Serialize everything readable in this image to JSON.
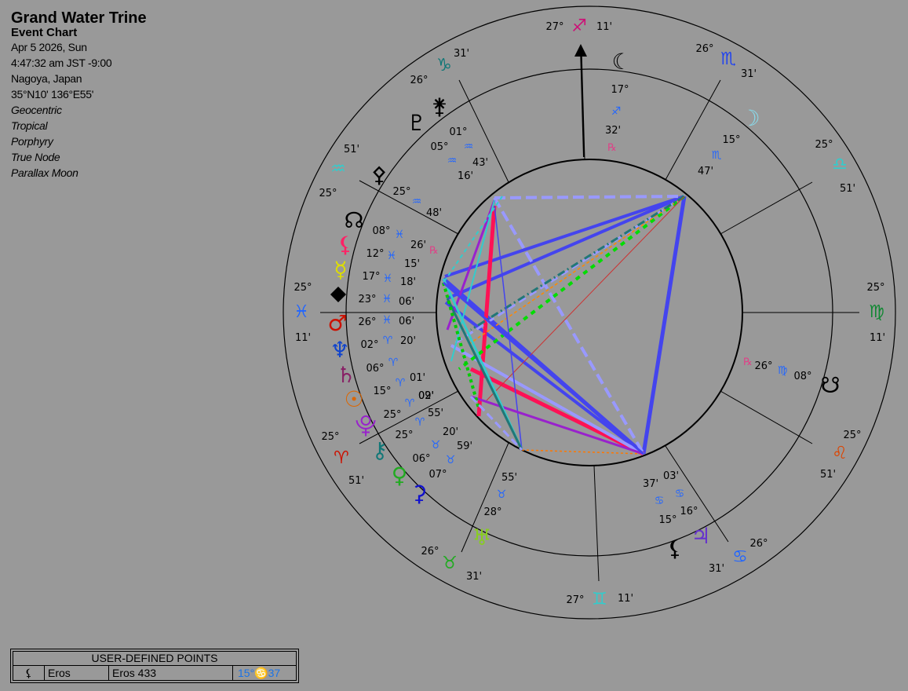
{
  "header": {
    "title": "Grand Water Trine",
    "subtitle": "Event Chart",
    "date": "Apr 5 2026, Sun",
    "time": "4:47:32 am  JST -9:00",
    "place": "Nagoya, Japan",
    "coords": "35°N10' 136°E55'",
    "settings": [
      "Geocentric",
      "Tropical",
      "Porphyry",
      "True Node",
      "Parallax Moon"
    ]
  },
  "colors": {
    "background": "#999999",
    "fire": "#cc1100",
    "earth": "#118833",
    "air": "#33cccc",
    "water": "#2266ff",
    "trine": "#4444ee",
    "square": "#ff1155",
    "sextile_dash": "#9999ff"
  },
  "signs_on_cusps": [
    {
      "sign": "sagittarius-glyph",
      "glyph": "♐",
      "deg": "27°",
      "min": "11'",
      "color": "#cc1177"
    },
    {
      "sign": "scorpio-glyph",
      "glyph": "♏",
      "deg": "26°",
      "min": "31'",
      "color": "#2244ee"
    },
    {
      "sign": "libra-glyph",
      "glyph": "♎",
      "deg": "25°",
      "min": "51'",
      "color": "#33cccc"
    },
    {
      "sign": "virgo-glyph",
      "glyph": "♍",
      "deg": "25°",
      "min": "11'",
      "color": "#118833"
    },
    {
      "sign": "leo-glyph",
      "glyph": "♌",
      "deg": "25°",
      "min": "51'",
      "color": "#dd4400"
    },
    {
      "sign": "cancer-glyph",
      "glyph": "♋",
      "deg": "26°",
      "min": "31'",
      "color": "#2266ff"
    },
    {
      "sign": "gemini-glyph",
      "glyph": "♊",
      "deg": "27°",
      "min": "11'",
      "color": "#33cccc"
    },
    {
      "sign": "taurus-glyph",
      "glyph": "♉",
      "deg": "26°",
      "min": "31'",
      "color": "#22aa22"
    },
    {
      "sign": "aries-glyph",
      "glyph": "♈",
      "deg": "25°",
      "min": "51'",
      "color": "#cc1100"
    },
    {
      "sign": "pisces-glyph",
      "glyph": "♓",
      "deg": "25°",
      "min": "11'",
      "color": "#2266ff"
    },
    {
      "sign": "aquarius-glyph",
      "glyph": "♒",
      "deg": "25°",
      "min": "51'",
      "color": "#33cccc"
    },
    {
      "sign": "capricorn-glyph",
      "glyph": "♑",
      "deg": "26°",
      "min": "31'",
      "color": "#117777"
    }
  ],
  "planets": [
    {
      "name": "moon",
      "glyph": "☾",
      "color": "#000000",
      "deg": "17°",
      "sign": "♐",
      "min": "32'",
      "retro": "℞"
    },
    {
      "name": "moon-2",
      "glyph": "☽",
      "color": "#88ddee",
      "deg": "15°",
      "sign": "♏",
      "min": "47'"
    },
    {
      "name": "south-node",
      "glyph": "☋",
      "color": "#000000",
      "deg": "26°",
      "sign": "♍",
      "min": "08°",
      "retro": "℞"
    },
    {
      "name": "jupiter",
      "glyph": "♃",
      "color": "#6633cc",
      "deg": "16°",
      "sign": "♋",
      "min": "03'"
    },
    {
      "name": "eros",
      "glyph": "⚸",
      "color": "#000000",
      "deg": "15°",
      "sign": "♋",
      "min": "37'"
    },
    {
      "name": "uranus",
      "glyph": "♅",
      "color": "#88cc22",
      "deg": "28°",
      "sign": "♉",
      "min": "55'"
    },
    {
      "name": "ceres",
      "glyph": "⚳",
      "color": "#1111cc",
      "deg": "07°",
      "sign": "♉",
      "min": "59'"
    },
    {
      "name": "venus",
      "glyph": "♀",
      "color": "#22aa22",
      "deg": "06°",
      "sign": "♉",
      "min": "20'"
    },
    {
      "name": "chiron",
      "glyph": "⚷",
      "color": "#117777",
      "deg": "25°",
      "sign": "♈",
      "min": "55'"
    },
    {
      "name": "proserpina",
      "glyph": "⯓",
      "color": "#9922cc",
      "deg": "25°",
      "sign": "♈",
      "min": "09'"
    },
    {
      "name": "sun",
      "glyph": "☉",
      "color": "#dd6600",
      "deg": "15°",
      "sign": "♈",
      "min": "02'"
    },
    {
      "name": "saturn",
      "glyph": "♄",
      "color": "#882266",
      "deg": "06°",
      "sign": "♈",
      "min": "01'"
    },
    {
      "name": "neptune",
      "glyph": "♆",
      "color": "#1144cc",
      "deg": "02°",
      "sign": "♈",
      "min": "20'"
    },
    {
      "name": "mars",
      "glyph": "♂",
      "color": "#cc1100",
      "deg": "26°",
      "sign": "♓",
      "min": "06'"
    },
    {
      "name": "vertex",
      "glyph": "⯁",
      "color": "#000000",
      "deg": "23°",
      "sign": "♓",
      "min": "06'"
    },
    {
      "name": "mercury",
      "glyph": "☿",
      "color": "#dddd00",
      "deg": "17°",
      "sign": "♓",
      "min": "18'"
    },
    {
      "name": "lilith",
      "glyph": "⚸",
      "color": "#ff2266",
      "deg": "12°",
      "sign": "♓",
      "min": "15'"
    },
    {
      "name": "north-node",
      "glyph": "☊",
      "color": "#000000",
      "deg": "08°",
      "sign": "♓",
      "min": "26'",
      "retro": "℞"
    },
    {
      "name": "pallas",
      "glyph": "⚴",
      "color": "#000000",
      "deg": "25°",
      "sign": "♒",
      "min": "48'"
    },
    {
      "name": "pluto",
      "glyph": "♇",
      "color": "#000000",
      "deg": "05°",
      "sign": "♒",
      "min": "43'"
    },
    {
      "name": "juno",
      "glyph": "⚵",
      "color": "#000000",
      "deg": "01°",
      "sign": "♒",
      "min": "16'"
    }
  ],
  "user_points": {
    "header": "USER-DEFINED POINTS",
    "rows": [
      {
        "glyph": "⚸",
        "name": "Eros",
        "desc": "Eros 433",
        "pos": "15°♋37"
      }
    ]
  }
}
